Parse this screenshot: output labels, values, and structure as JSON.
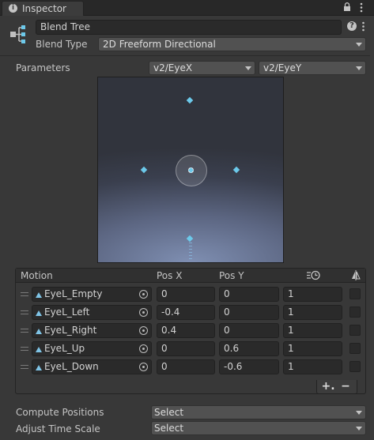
{
  "window": {
    "tab_title": "Inspector",
    "lock_icon": "lock-icon",
    "menu_icon": "kebab-menu-icon"
  },
  "blend_tree": {
    "name": "Blend Tree",
    "blend_type_label": "Blend Type",
    "blend_type_value": "2D Freeform Directional",
    "parameters_label": "Parameters",
    "param_x": "v2/EyeX",
    "param_y": "v2/EyeY"
  },
  "motion_list": {
    "headers": {
      "motion": "Motion",
      "pos_x": "Pos X",
      "pos_y": "Pos Y",
      "speed_icon": "time-scale-icon",
      "mirror_icon": "mirror-icon"
    },
    "rows": [
      {
        "motion": "EyeL_Empty",
        "pos_x": "0",
        "pos_y": "0",
        "speed": "1"
      },
      {
        "motion": "EyeL_Left",
        "pos_x": "-0.4",
        "pos_y": "0",
        "speed": "1"
      },
      {
        "motion": "EyeL_Right",
        "pos_x": "0.4",
        "pos_y": "0",
        "speed": "1"
      },
      {
        "motion": "EyeL_Up",
        "pos_x": "0",
        "pos_y": "0.6",
        "speed": "1"
      },
      {
        "motion": "EyeL_Down",
        "pos_x": "0",
        "pos_y": "-0.6",
        "speed": "1"
      }
    ],
    "add_label": "+.",
    "remove_label": "−"
  },
  "compute_positions": {
    "label": "Compute Positions",
    "value": "Select"
  },
  "adjust_time_scale": {
    "label": "Adjust Time Scale",
    "value": "Select"
  },
  "colors": {
    "sample_point": "#6cc9ea",
    "current_point": "#e05a5a",
    "graph_glow": "#7f8fb2"
  }
}
